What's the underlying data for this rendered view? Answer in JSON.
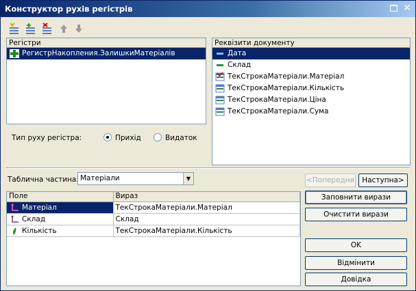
{
  "window": {
    "title": "Конструктор рухів регістрів"
  },
  "toolbar": {
    "buttons": [
      {
        "icon": "add-register-icon"
      },
      {
        "icon": "add-all-registers-icon"
      },
      {
        "icon": "delete-register-icon"
      },
      {
        "icon": "arrow-up-icon"
      },
      {
        "icon": "arrow-down-icon"
      }
    ]
  },
  "registers": {
    "header": "Регістри",
    "items": [
      {
        "label": "РегистрНакопления.ЗалишкиМатеріалів",
        "icon": "plus-green-icon"
      }
    ]
  },
  "requisites": {
    "header": "Реквізити документу",
    "items": [
      {
        "label": "Дата",
        "icon": "attribute-icon"
      },
      {
        "label": "Склад",
        "icon": "attribute-icon"
      },
      {
        "label": "ТекСтрокаМатеріали.Матеріал",
        "icon": "tabular-attribute-icon"
      },
      {
        "label": "ТекСтрокаМатеріали.Кількість",
        "icon": "tabular-attribute-icon"
      },
      {
        "label": "ТекСтрокаМатеріали.Ціна",
        "icon": "tabular-attribute-icon"
      },
      {
        "label": "ТекСтрокаМатеріали.Сума",
        "icon": "tabular-attribute-icon"
      }
    ]
  },
  "movement_type": {
    "label": "Тип руху регістра:",
    "options": [
      {
        "label": "Прихід",
        "selected": true
      },
      {
        "label": "Видаток",
        "selected": false
      }
    ]
  },
  "tabular": {
    "label": "Таблична частина:",
    "value": "Матеріали"
  },
  "nav": {
    "prev": "<Попередня",
    "next": "Наступна>"
  },
  "grid": {
    "columns": [
      "Поле",
      "Вираз"
    ],
    "rows": [
      {
        "field": "Матеріал",
        "expr": "ТекСтрокаМатеріали.Матеріал",
        "icon": "dimension-icon"
      },
      {
        "field": "Склад",
        "expr": "Склад",
        "icon": "dimension-icon"
      },
      {
        "field": "Кількість",
        "expr": "ТекСтрокаМатеріали.Кількість",
        "icon": "resource-icon"
      }
    ]
  },
  "actions": {
    "fill": "Заповнити вирази",
    "clear": "Очистити вирази",
    "ok": "OK",
    "cancel": "Відмінити",
    "help": "Довідка"
  }
}
